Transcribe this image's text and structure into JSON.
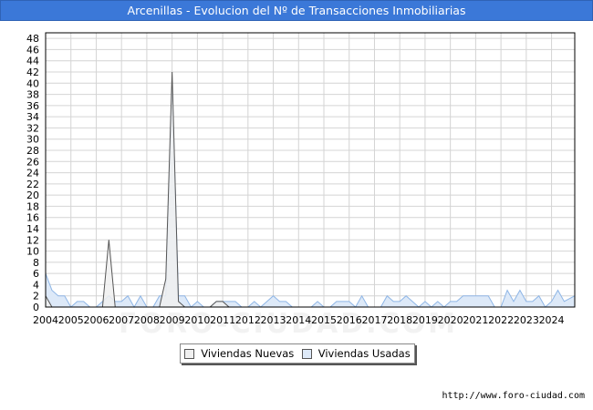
{
  "title": "Arcenillas - Evolucion del Nº de Transacciones Inmobiliarias",
  "watermark": "FORO-CIUDAD.COM",
  "source": "http://www.foro-ciudad.com",
  "colors": {
    "title_bg": "#3b78d8",
    "nuevas": "#f0f0f0",
    "usadas": "#dde9f8",
    "usadas_line": "#8fb6e6"
  },
  "chart_data": {
    "type": "area",
    "title": "Arcenillas - Evolucion del Nº de Transacciones Inmobiliarias",
    "x_tick_labels": [
      "2004",
      "2005",
      "2006",
      "2007",
      "2008",
      "2009",
      "2010",
      "2011",
      "2012",
      "2013",
      "2014",
      "2015",
      "2016",
      "2017",
      "2018",
      "2019",
      "2020",
      "2021",
      "2022",
      "2023",
      "2024"
    ],
    "y_ticks": [
      0,
      2,
      4,
      6,
      8,
      10,
      12,
      14,
      16,
      18,
      20,
      22,
      24,
      26,
      28,
      30,
      32,
      34,
      36,
      38,
      40,
      42,
      44,
      46,
      48
    ],
    "ylim": [
      0,
      49
    ],
    "xlim": [
      2004,
      2024.917
    ],
    "grid": true,
    "legend_position": "bottom-center",
    "series": [
      {
        "name": "Viviendas Nuevas",
        "color": "#f0f0f0",
        "line_color": "#555555",
        "points": [
          [
            2004,
            2
          ],
          [
            2004.25,
            0
          ],
          [
            2006.25,
            0
          ],
          [
            2006.5,
            12
          ],
          [
            2006.75,
            0
          ],
          [
            2008.5,
            0
          ],
          [
            2008.75,
            5
          ],
          [
            2009,
            42
          ],
          [
            2009.25,
            1
          ],
          [
            2009.5,
            0
          ],
          [
            2010.5,
            0
          ],
          [
            2010.75,
            1
          ],
          [
            2011,
            1
          ],
          [
            2011.25,
            0
          ],
          [
            2024.917,
            0
          ]
        ]
      },
      {
        "name": "Viviendas Usadas",
        "color": "#dde9f8",
        "line_color": "#8fb6e6",
        "points": [
          [
            2004,
            6
          ],
          [
            2004.25,
            3
          ],
          [
            2004.5,
            2
          ],
          [
            2004.75,
            2
          ],
          [
            2005,
            0
          ],
          [
            2005.25,
            1
          ],
          [
            2005.5,
            1
          ],
          [
            2005.75,
            0
          ],
          [
            2006,
            0
          ],
          [
            2006.25,
            1
          ],
          [
            2006.5,
            2
          ],
          [
            2006.75,
            1
          ],
          [
            2007,
            1
          ],
          [
            2007.25,
            2
          ],
          [
            2007.5,
            0
          ],
          [
            2007.75,
            2
          ],
          [
            2008,
            0
          ],
          [
            2008.25,
            0
          ],
          [
            2008.5,
            2
          ],
          [
            2008.75,
            2
          ],
          [
            2009,
            40
          ],
          [
            2009.25,
            2
          ],
          [
            2009.5,
            2
          ],
          [
            2009.75,
            0
          ],
          [
            2010,
            1
          ],
          [
            2010.25,
            0
          ],
          [
            2010.5,
            0
          ],
          [
            2010.75,
            1
          ],
          [
            2011,
            1
          ],
          [
            2011.25,
            1
          ],
          [
            2011.5,
            1
          ],
          [
            2011.75,
            0
          ],
          [
            2012,
            0
          ],
          [
            2012.25,
            1
          ],
          [
            2012.5,
            0
          ],
          [
            2012.75,
            1
          ],
          [
            2013,
            2
          ],
          [
            2013.25,
            1
          ],
          [
            2013.5,
            1
          ],
          [
            2013.75,
            0
          ],
          [
            2014,
            0
          ],
          [
            2014.25,
            0
          ],
          [
            2014.5,
            0
          ],
          [
            2014.75,
            1
          ],
          [
            2015,
            0
          ],
          [
            2015.25,
            0
          ],
          [
            2015.5,
            1
          ],
          [
            2015.75,
            1
          ],
          [
            2016,
            1
          ],
          [
            2016.25,
            0
          ],
          [
            2016.5,
            2
          ],
          [
            2016.75,
            0
          ],
          [
            2017,
            0
          ],
          [
            2017.25,
            0
          ],
          [
            2017.5,
            2
          ],
          [
            2017.75,
            1
          ],
          [
            2018,
            1
          ],
          [
            2018.25,
            2
          ],
          [
            2018.5,
            1
          ],
          [
            2018.75,
            0
          ],
          [
            2019,
            1
          ],
          [
            2019.25,
            0
          ],
          [
            2019.5,
            1
          ],
          [
            2019.75,
            0
          ],
          [
            2020,
            1
          ],
          [
            2020.25,
            1
          ],
          [
            2020.5,
            2
          ],
          [
            2020.75,
            2
          ],
          [
            2021,
            2
          ],
          [
            2021.25,
            2
          ],
          [
            2021.5,
            2
          ],
          [
            2021.75,
            0
          ],
          [
            2022,
            0
          ],
          [
            2022.25,
            3
          ],
          [
            2022.5,
            1
          ],
          [
            2022.75,
            3
          ],
          [
            2023,
            1
          ],
          [
            2023.25,
            1
          ],
          [
            2023.5,
            2
          ],
          [
            2023.75,
            0
          ],
          [
            2024,
            1
          ],
          [
            2024.25,
            3
          ],
          [
            2024.5,
            1
          ],
          [
            2024.917,
            2
          ]
        ]
      }
    ]
  }
}
